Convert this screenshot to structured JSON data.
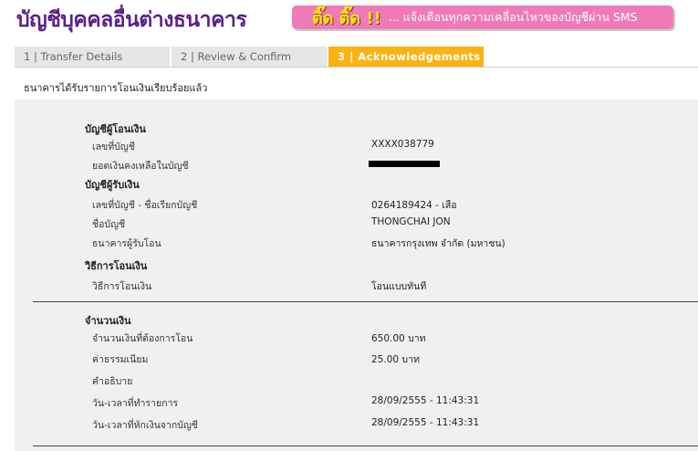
{
  "header": {
    "title": "บัญชีบุคคลอื่นต่างธนาคาร",
    "banner_tag": "ติ๊ด ติ๊ด !!",
    "banner_text": "... แจ้งเตือนทุกความเคลื่อนไหวของบัญชีผ่าน SMS"
  },
  "steps": [
    {
      "label": "1 | Transfer Details"
    },
    {
      "label": "2 | Review & Confirm"
    },
    {
      "label": "3 | Acknowledgements"
    }
  ],
  "notice": "ธนาคารได้รับรายการโอนเงินเรียบร้อยแล้ว",
  "from_account": {
    "heading": "บัญชีผู้โอนเงิน",
    "account_no_label": "เลขที่บัญชี",
    "account_no": "XXXX038779",
    "balance_label": "ยอดเงินคงเหลือในบัญชี"
  },
  "to_account": {
    "heading": "บัญชีผู้รับเงิน",
    "account_label": "เลขที่บัญชี - ชื่อเรียกบัญชี",
    "account": "0264189424 - เสือ",
    "name_label": "ชื่อบัญชี",
    "name": "THONGCHAI JON",
    "bank_label": "ธนาคารผู้รับโอน",
    "bank": "ธนาคารกรุงเทพ จำกัด (มหาชน)"
  },
  "method": {
    "heading": "วิธีการโอนเงิน",
    "label": "วิธีการโอนเงิน",
    "value": "โอนแบบทันที"
  },
  "amount": {
    "heading": "จำนวนเงิน",
    "amount_label": "จำนวนเงินที่ต้องการโอน",
    "amount": "650.00 บาท",
    "fee_label": "ค่าธรรมเนียม",
    "fee": "25.00 บาท",
    "desc_label": "คำอธิบาย",
    "txn_time_label": "วัน-เวลาที่ทำรายการ",
    "txn_time": "28/09/2555 - 11:43:31",
    "debit_time_label": "วัน-เวลาที่หักเงินจากบัญชี",
    "debit_time": "28/09/2555 - 11:43:31"
  }
}
